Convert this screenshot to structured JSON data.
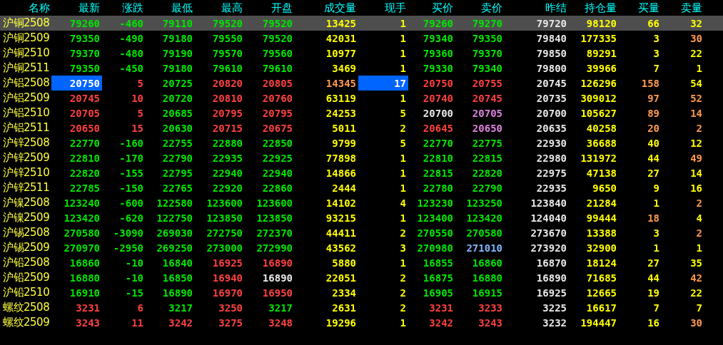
{
  "table": {
    "columns": [
      "名称",
      "最新",
      "涨跌",
      "最低",
      "最高",
      "开盘",
      "成交量",
      "现手",
      "买价",
      "卖价",
      "昨结",
      "持仓量",
      "买量",
      "卖量"
    ],
    "rows": [
      {
        "selected": true,
        "cells": [
          {
            "text": "沪铜2508",
            "color": "#ffff40"
          },
          {
            "text": "79260",
            "color": "#00e600"
          },
          {
            "text": "-460",
            "color": "#00e600"
          },
          {
            "text": "79110",
            "color": "#00e600"
          },
          {
            "text": "79520",
            "color": "#00e600"
          },
          {
            "text": "79520",
            "color": "#00e600"
          },
          {
            "text": "13425",
            "color": "#ffff00"
          },
          {
            "text": "1",
            "color": "#ffff00"
          },
          {
            "text": "79260",
            "color": "#00e600"
          },
          {
            "text": "79270",
            "color": "#00e600"
          },
          {
            "text": "79720",
            "color": "#e8e8e8"
          },
          {
            "text": "98120",
            "color": "#ffff00"
          },
          {
            "text": "66",
            "color": "#ffff00"
          },
          {
            "text": "32",
            "color": "#ffff00"
          }
        ]
      },
      {
        "selected": false,
        "cells": [
          {
            "text": "沪铜2509",
            "color": "#ffff40"
          },
          {
            "text": "79350",
            "color": "#00e600"
          },
          {
            "text": "-490",
            "color": "#00e600"
          },
          {
            "text": "79180",
            "color": "#00e600"
          },
          {
            "text": "79550",
            "color": "#00e600"
          },
          {
            "text": "79520",
            "color": "#00e600"
          },
          {
            "text": "42031",
            "color": "#ffff00"
          },
          {
            "text": "1",
            "color": "#ffff00"
          },
          {
            "text": "79340",
            "color": "#00e600"
          },
          {
            "text": "79350",
            "color": "#00e600"
          },
          {
            "text": "79840",
            "color": "#e8e8e8"
          },
          {
            "text": "177335",
            "color": "#ffff00"
          },
          {
            "text": "3",
            "color": "#ffff00"
          },
          {
            "text": "30",
            "color": "#ff9a50"
          }
        ]
      },
      {
        "selected": false,
        "cells": [
          {
            "text": "沪铜2510",
            "color": "#ffff40"
          },
          {
            "text": "79370",
            "color": "#00e600"
          },
          {
            "text": "-480",
            "color": "#00e600"
          },
          {
            "text": "79190",
            "color": "#00e600"
          },
          {
            "text": "79570",
            "color": "#00e600"
          },
          {
            "text": "79560",
            "color": "#00e600"
          },
          {
            "text": "10977",
            "color": "#ffff00"
          },
          {
            "text": "1",
            "color": "#ffff00"
          },
          {
            "text": "79360",
            "color": "#00e600"
          },
          {
            "text": "79370",
            "color": "#00e600"
          },
          {
            "text": "79850",
            "color": "#e8e8e8"
          },
          {
            "text": "89291",
            "color": "#ffff00"
          },
          {
            "text": "3",
            "color": "#ffff00"
          },
          {
            "text": "22",
            "color": "#ffff00"
          }
        ]
      },
      {
        "selected": false,
        "cells": [
          {
            "text": "沪铜2511",
            "color": "#ffff40"
          },
          {
            "text": "79350",
            "color": "#00e600"
          },
          {
            "text": "-450",
            "color": "#00e600"
          },
          {
            "text": "79180",
            "color": "#00e600"
          },
          {
            "text": "79610",
            "color": "#00e600"
          },
          {
            "text": "79610",
            "color": "#00e600"
          },
          {
            "text": "3469",
            "color": "#ffff00"
          },
          {
            "text": "1",
            "color": "#ffff00"
          },
          {
            "text": "79330",
            "color": "#00e600"
          },
          {
            "text": "79340",
            "color": "#00e600"
          },
          {
            "text": "79800",
            "color": "#e8e8e8"
          },
          {
            "text": "39966",
            "color": "#ffff00"
          },
          {
            "text": "7",
            "color": "#ffff00"
          },
          {
            "text": "1",
            "color": "#ffff00"
          }
        ]
      },
      {
        "selected": false,
        "cells": [
          {
            "text": "沪铝2508",
            "color": "#ffff40"
          },
          {
            "text": "20750",
            "color": "#ffffff",
            "flash": true
          },
          {
            "text": "5",
            "color": "#ff4040"
          },
          {
            "text": "20725",
            "color": "#00e600"
          },
          {
            "text": "20820",
            "color": "#ff4040"
          },
          {
            "text": "20805",
            "color": "#ff4040"
          },
          {
            "text": "14345",
            "color": "#ff9a50"
          },
          {
            "text": "17",
            "color": "#ffffff",
            "flash": true
          },
          {
            "text": "20750",
            "color": "#ff4040"
          },
          {
            "text": "20755",
            "color": "#ff4040"
          },
          {
            "text": "20745",
            "color": "#e8e8e8"
          },
          {
            "text": "126296",
            "color": "#ffff00"
          },
          {
            "text": "158",
            "color": "#ff9a50"
          },
          {
            "text": "54",
            "color": "#ffff00"
          }
        ]
      },
      {
        "selected": false,
        "cells": [
          {
            "text": "沪铝2509",
            "color": "#ffff40"
          },
          {
            "text": "20745",
            "color": "#ff4040"
          },
          {
            "text": "10",
            "color": "#ff4040"
          },
          {
            "text": "20720",
            "color": "#00e600"
          },
          {
            "text": "20810",
            "color": "#ff4040"
          },
          {
            "text": "20760",
            "color": "#ff4040"
          },
          {
            "text": "63119",
            "color": "#ffff00"
          },
          {
            "text": "1",
            "color": "#ffff00"
          },
          {
            "text": "20740",
            "color": "#ff4040"
          },
          {
            "text": "20745",
            "color": "#ff4040"
          },
          {
            "text": "20735",
            "color": "#e8e8e8"
          },
          {
            "text": "309012",
            "color": "#ffff00"
          },
          {
            "text": "97",
            "color": "#ff9a50"
          },
          {
            "text": "52",
            "color": "#ff9a50"
          }
        ]
      },
      {
        "selected": false,
        "cells": [
          {
            "text": "沪铝2510",
            "color": "#ffff40"
          },
          {
            "text": "20705",
            "color": "#ff4040"
          },
          {
            "text": "5",
            "color": "#ff4040"
          },
          {
            "text": "20685",
            "color": "#00e600"
          },
          {
            "text": "20795",
            "color": "#ff4040"
          },
          {
            "text": "20795",
            "color": "#ff4040"
          },
          {
            "text": "24253",
            "color": "#ffff00"
          },
          {
            "text": "5",
            "color": "#ffff00"
          },
          {
            "text": "20700",
            "color": "#e8e8e8"
          },
          {
            "text": "20705",
            "color": "#e080e0"
          },
          {
            "text": "20700",
            "color": "#e8e8e8"
          },
          {
            "text": "105627",
            "color": "#ffff00"
          },
          {
            "text": "89",
            "color": "#ff9a50"
          },
          {
            "text": "14",
            "color": "#ff9a50"
          }
        ]
      },
      {
        "selected": false,
        "cells": [
          {
            "text": "沪铝2511",
            "color": "#ffff40"
          },
          {
            "text": "20650",
            "color": "#ff4040"
          },
          {
            "text": "15",
            "color": "#ff4040"
          },
          {
            "text": "20630",
            "color": "#00e600"
          },
          {
            "text": "20715",
            "color": "#ff4040"
          },
          {
            "text": "20675",
            "color": "#ff4040"
          },
          {
            "text": "5011",
            "color": "#ffff00"
          },
          {
            "text": "2",
            "color": "#ffff00"
          },
          {
            "text": "20645",
            "color": "#ff4040"
          },
          {
            "text": "20650",
            "color": "#e080e0"
          },
          {
            "text": "20635",
            "color": "#e8e8e8"
          },
          {
            "text": "40258",
            "color": "#ffff00"
          },
          {
            "text": "20",
            "color": "#ff9a50"
          },
          {
            "text": "2",
            "color": "#ff9a50"
          }
        ]
      },
      {
        "selected": false,
        "cells": [
          {
            "text": "沪锌2508",
            "color": "#ffff40"
          },
          {
            "text": "22770",
            "color": "#00e600"
          },
          {
            "text": "-160",
            "color": "#00e600"
          },
          {
            "text": "22755",
            "color": "#00e600"
          },
          {
            "text": "22880",
            "color": "#00e600"
          },
          {
            "text": "22850",
            "color": "#00e600"
          },
          {
            "text": "9799",
            "color": "#ffff00"
          },
          {
            "text": "5",
            "color": "#ffff00"
          },
          {
            "text": "22770",
            "color": "#00e600"
          },
          {
            "text": "22775",
            "color": "#00e600"
          },
          {
            "text": "22930",
            "color": "#e8e8e8"
          },
          {
            "text": "36688",
            "color": "#ffff00"
          },
          {
            "text": "40",
            "color": "#ffff00"
          },
          {
            "text": "12",
            "color": "#ffff00"
          }
        ]
      },
      {
        "selected": false,
        "cells": [
          {
            "text": "沪锌2509",
            "color": "#ffff40"
          },
          {
            "text": "22810",
            "color": "#00e600"
          },
          {
            "text": "-170",
            "color": "#00e600"
          },
          {
            "text": "22790",
            "color": "#00e600"
          },
          {
            "text": "22935",
            "color": "#00e600"
          },
          {
            "text": "22925",
            "color": "#00e600"
          },
          {
            "text": "77898",
            "color": "#ffff00"
          },
          {
            "text": "1",
            "color": "#ffff00"
          },
          {
            "text": "22810",
            "color": "#00e600"
          },
          {
            "text": "22815",
            "color": "#00e600"
          },
          {
            "text": "22980",
            "color": "#e8e8e8"
          },
          {
            "text": "131972",
            "color": "#ffff00"
          },
          {
            "text": "44",
            "color": "#ffff00"
          },
          {
            "text": "49",
            "color": "#ff9a50"
          }
        ]
      },
      {
        "selected": false,
        "cells": [
          {
            "text": "沪锌2510",
            "color": "#ffff40"
          },
          {
            "text": "22820",
            "color": "#00e600"
          },
          {
            "text": "-155",
            "color": "#00e600"
          },
          {
            "text": "22795",
            "color": "#00e600"
          },
          {
            "text": "22940",
            "color": "#00e600"
          },
          {
            "text": "22940",
            "color": "#00e600"
          },
          {
            "text": "14866",
            "color": "#ffff00"
          },
          {
            "text": "1",
            "color": "#ffff00"
          },
          {
            "text": "22815",
            "color": "#00e600"
          },
          {
            "text": "22820",
            "color": "#00e600"
          },
          {
            "text": "22975",
            "color": "#e8e8e8"
          },
          {
            "text": "47138",
            "color": "#ffff00"
          },
          {
            "text": "27",
            "color": "#ffff00"
          },
          {
            "text": "14",
            "color": "#ffff00"
          }
        ]
      },
      {
        "selected": false,
        "cells": [
          {
            "text": "沪锌2511",
            "color": "#ffff40"
          },
          {
            "text": "22785",
            "color": "#00e600"
          },
          {
            "text": "-150",
            "color": "#00e600"
          },
          {
            "text": "22765",
            "color": "#00e600"
          },
          {
            "text": "22920",
            "color": "#00e600"
          },
          {
            "text": "22860",
            "color": "#00e600"
          },
          {
            "text": "2444",
            "color": "#ffff00"
          },
          {
            "text": "1",
            "color": "#ffff00"
          },
          {
            "text": "22780",
            "color": "#00e600"
          },
          {
            "text": "22790",
            "color": "#00e600"
          },
          {
            "text": "22935",
            "color": "#e8e8e8"
          },
          {
            "text": "9650",
            "color": "#ffff00"
          },
          {
            "text": "9",
            "color": "#ffff00"
          },
          {
            "text": "16",
            "color": "#ffff00"
          }
        ]
      },
      {
        "selected": false,
        "cells": [
          {
            "text": "沪镍2508",
            "color": "#ffff40"
          },
          {
            "text": "123240",
            "color": "#00e600"
          },
          {
            "text": "-600",
            "color": "#00e600"
          },
          {
            "text": "122580",
            "color": "#00e600"
          },
          {
            "text": "123600",
            "color": "#00e600"
          },
          {
            "text": "123600",
            "color": "#00e600"
          },
          {
            "text": "14102",
            "color": "#ffff00"
          },
          {
            "text": "4",
            "color": "#ffff00"
          },
          {
            "text": "123230",
            "color": "#00e600"
          },
          {
            "text": "123250",
            "color": "#00e600"
          },
          {
            "text": "123840",
            "color": "#e8e8e8"
          },
          {
            "text": "21284",
            "color": "#ffff00"
          },
          {
            "text": "1",
            "color": "#ffff00"
          },
          {
            "text": "2",
            "color": "#ff9a50"
          }
        ]
      },
      {
        "selected": false,
        "cells": [
          {
            "text": "沪镍2509",
            "color": "#ffff40"
          },
          {
            "text": "123420",
            "color": "#00e600"
          },
          {
            "text": "-620",
            "color": "#00e600"
          },
          {
            "text": "122750",
            "color": "#00e600"
          },
          {
            "text": "123850",
            "color": "#00e600"
          },
          {
            "text": "123850",
            "color": "#00e600"
          },
          {
            "text": "93215",
            "color": "#ffff00"
          },
          {
            "text": "1",
            "color": "#ffff00"
          },
          {
            "text": "123400",
            "color": "#00e600"
          },
          {
            "text": "123420",
            "color": "#00e600"
          },
          {
            "text": "124040",
            "color": "#e8e8e8"
          },
          {
            "text": "99444",
            "color": "#ffff00"
          },
          {
            "text": "18",
            "color": "#ff9a50"
          },
          {
            "text": "4",
            "color": "#ffff00"
          }
        ]
      },
      {
        "selected": false,
        "cells": [
          {
            "text": "沪锡2508",
            "color": "#ffff40"
          },
          {
            "text": "270580",
            "color": "#00e600"
          },
          {
            "text": "-3090",
            "color": "#00e600"
          },
          {
            "text": "269030",
            "color": "#00e600"
          },
          {
            "text": "272750",
            "color": "#00e600"
          },
          {
            "text": "272370",
            "color": "#00e600"
          },
          {
            "text": "44411",
            "color": "#ffff00"
          },
          {
            "text": "2",
            "color": "#ffff00"
          },
          {
            "text": "270550",
            "color": "#00e600"
          },
          {
            "text": "270580",
            "color": "#00e600"
          },
          {
            "text": "273670",
            "color": "#e8e8e8"
          },
          {
            "text": "13388",
            "color": "#ffff00"
          },
          {
            "text": "3",
            "color": "#ffff00"
          },
          {
            "text": "2",
            "color": "#ff9a50"
          }
        ]
      },
      {
        "selected": false,
        "cells": [
          {
            "text": "沪锡2509",
            "color": "#ffff40"
          },
          {
            "text": "270970",
            "color": "#00e600"
          },
          {
            "text": "-2950",
            "color": "#00e600"
          },
          {
            "text": "269250",
            "color": "#00e600"
          },
          {
            "text": "273000",
            "color": "#00e600"
          },
          {
            "text": "272990",
            "color": "#00e600"
          },
          {
            "text": "43562",
            "color": "#ffff00"
          },
          {
            "text": "3",
            "color": "#ffff00"
          },
          {
            "text": "270980",
            "color": "#00e600"
          },
          {
            "text": "271010",
            "color": "#80b8ff"
          },
          {
            "text": "273920",
            "color": "#e8e8e8"
          },
          {
            "text": "32900",
            "color": "#ffff00"
          },
          {
            "text": "1",
            "color": "#ffff00"
          },
          {
            "text": "1",
            "color": "#ffff00"
          }
        ]
      },
      {
        "selected": false,
        "cells": [
          {
            "text": "沪铅2508",
            "color": "#ffff40"
          },
          {
            "text": "16860",
            "color": "#00e600"
          },
          {
            "text": "-10",
            "color": "#00e600"
          },
          {
            "text": "16840",
            "color": "#00e600"
          },
          {
            "text": "16925",
            "color": "#ff4040"
          },
          {
            "text": "16890",
            "color": "#ff4040"
          },
          {
            "text": "5880",
            "color": "#ffff00"
          },
          {
            "text": "1",
            "color": "#ffff00"
          },
          {
            "text": "16855",
            "color": "#00e600"
          },
          {
            "text": "16860",
            "color": "#00e600"
          },
          {
            "text": "16870",
            "color": "#e8e8e8"
          },
          {
            "text": "18124",
            "color": "#ffff00"
          },
          {
            "text": "27",
            "color": "#ffff00"
          },
          {
            "text": "35",
            "color": "#ffff00"
          }
        ]
      },
      {
        "selected": false,
        "cells": [
          {
            "text": "沪铅2509",
            "color": "#ffff40"
          },
          {
            "text": "16880",
            "color": "#00e600"
          },
          {
            "text": "-10",
            "color": "#00e600"
          },
          {
            "text": "16850",
            "color": "#00e600"
          },
          {
            "text": "16940",
            "color": "#ff4040"
          },
          {
            "text": "16890",
            "color": "#e8e8e8"
          },
          {
            "text": "22051",
            "color": "#ffff00"
          },
          {
            "text": "2",
            "color": "#ffff00"
          },
          {
            "text": "16875",
            "color": "#00e600"
          },
          {
            "text": "16880",
            "color": "#00e600"
          },
          {
            "text": "16890",
            "color": "#e8e8e8"
          },
          {
            "text": "71685",
            "color": "#ffff00"
          },
          {
            "text": "44",
            "color": "#ffff00"
          },
          {
            "text": "42",
            "color": "#ff9a50"
          }
        ]
      },
      {
        "selected": false,
        "cells": [
          {
            "text": "沪铅2510",
            "color": "#ffff40"
          },
          {
            "text": "16910",
            "color": "#00e600"
          },
          {
            "text": "-15",
            "color": "#00e600"
          },
          {
            "text": "16890",
            "color": "#00e600"
          },
          {
            "text": "16970",
            "color": "#ff4040"
          },
          {
            "text": "16950",
            "color": "#ff4040"
          },
          {
            "text": "2334",
            "color": "#ffff00"
          },
          {
            "text": "2",
            "color": "#ffff00"
          },
          {
            "text": "16905",
            "color": "#00e600"
          },
          {
            "text": "16915",
            "color": "#00e600"
          },
          {
            "text": "16925",
            "color": "#e8e8e8"
          },
          {
            "text": "12665",
            "color": "#ffff00"
          },
          {
            "text": "19",
            "color": "#ffff00"
          },
          {
            "text": "22",
            "color": "#ffff00"
          }
        ]
      },
      {
        "selected": false,
        "cells": [
          {
            "text": "螺纹2508",
            "color": "#ffff40"
          },
          {
            "text": "3231",
            "color": "#ff4040"
          },
          {
            "text": "6",
            "color": "#ff4040"
          },
          {
            "text": "3217",
            "color": "#00e600"
          },
          {
            "text": "3250",
            "color": "#ff4040"
          },
          {
            "text": "3217",
            "color": "#00e600"
          },
          {
            "text": "2631",
            "color": "#ffff00"
          },
          {
            "text": "2",
            "color": "#ffff00"
          },
          {
            "text": "3231",
            "color": "#ff4040"
          },
          {
            "text": "3233",
            "color": "#ff4040"
          },
          {
            "text": "3225",
            "color": "#e8e8e8"
          },
          {
            "text": "16617",
            "color": "#ffff00"
          },
          {
            "text": "7",
            "color": "#ffff00"
          },
          {
            "text": "7",
            "color": "#ffff00"
          }
        ]
      },
      {
        "selected": false,
        "cells": [
          {
            "text": "螺纹2509",
            "color": "#ffff40"
          },
          {
            "text": "3243",
            "color": "#ff4040"
          },
          {
            "text": "11",
            "color": "#ff4040"
          },
          {
            "text": "3242",
            "color": "#ff4040"
          },
          {
            "text": "3275",
            "color": "#ff4040"
          },
          {
            "text": "3248",
            "color": "#ff4040"
          },
          {
            "text": "19296",
            "color": "#ffff00"
          },
          {
            "text": "1",
            "color": "#ffff00"
          },
          {
            "text": "3242",
            "color": "#ff4040"
          },
          {
            "text": "3243",
            "color": "#ff4040"
          },
          {
            "text": "3232",
            "color": "#e8e8e8"
          },
          {
            "text": "194447",
            "color": "#ffff00"
          },
          {
            "text": "16",
            "color": "#ffff00"
          },
          {
            "text": "30",
            "color": "#ff9a50"
          }
        ]
      }
    ]
  }
}
